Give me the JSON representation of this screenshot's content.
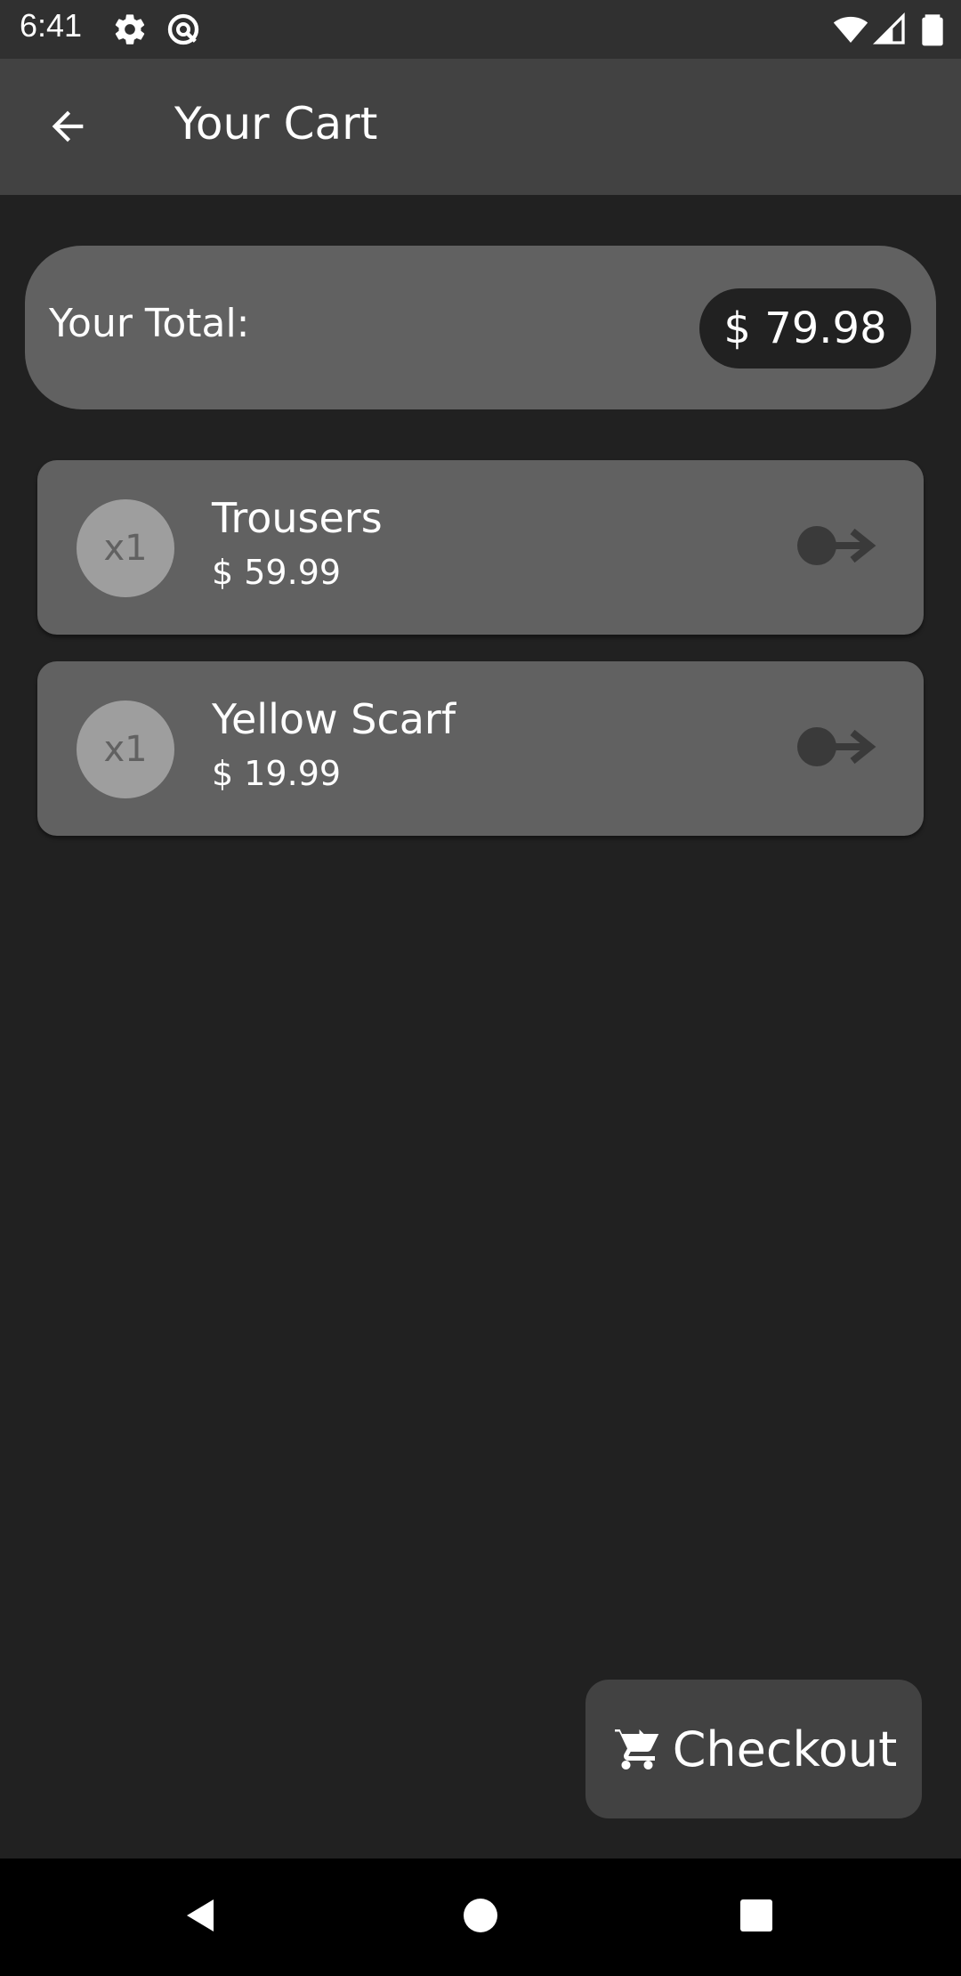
{
  "status_bar": {
    "time": "6:41",
    "left_icons": [
      "settings-icon",
      "sync-icon"
    ],
    "right_icons": [
      "wifi-icon",
      "signal-icon",
      "battery-icon"
    ]
  },
  "app_bar": {
    "back_icon": "arrow-back-icon",
    "title": "Your Cart"
  },
  "total": {
    "label": "Your Total:",
    "amount": "$ 79.98"
  },
  "cart": {
    "items": [
      {
        "quantity": "x1",
        "name": "Trousers",
        "price": "$ 59.99",
        "action_icon": "remove-from-cart-icon"
      },
      {
        "quantity": "x1",
        "name": "Yellow Scarf",
        "price": "$ 19.99",
        "action_icon": "remove-from-cart-icon"
      }
    ]
  },
  "checkout": {
    "icon": "cart-checkout-icon",
    "label": "Checkout"
  },
  "nav_bar": {
    "buttons": [
      "back-triangle-icon",
      "home-circle-icon",
      "recents-square-icon"
    ]
  },
  "colors": {
    "background": "#212121",
    "app_bar": "#424242",
    "card": "#616161",
    "badge": "#9e9e9e",
    "pill": "#212121"
  }
}
